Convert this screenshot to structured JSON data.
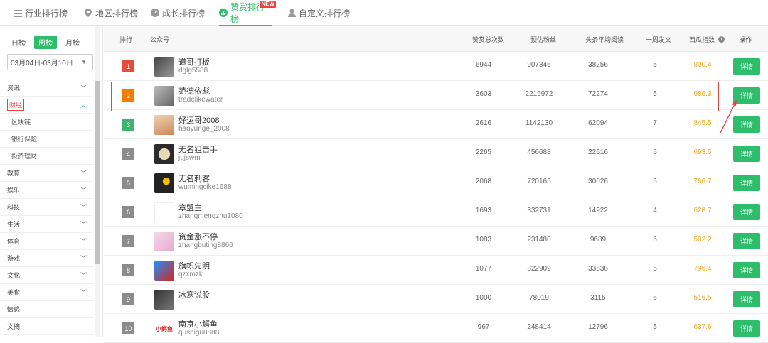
{
  "tabs": [
    {
      "label": "行业排行榜",
      "icon": "list-icon"
    },
    {
      "label": "地区排行榜",
      "icon": "location-pin-icon"
    },
    {
      "label": "成长排行榜",
      "icon": "speedometer-icon"
    },
    {
      "label": "赞赏排行榜",
      "icon": "thumbs-up-icon",
      "badge": "NEW"
    },
    {
      "label": "自定义排行榜",
      "icon": "user-icon"
    }
  ],
  "sidebar": {
    "periods": [
      "日榜",
      "周榜",
      "月榜"
    ],
    "date_range": "03月04日-03月10日",
    "categories": [
      {
        "label": "资讯"
      },
      {
        "label": "财经"
      },
      {
        "label": "区块链"
      },
      {
        "label": "银行保险"
      },
      {
        "label": "投资理财"
      },
      {
        "label": "教育"
      },
      {
        "label": "娱乐"
      },
      {
        "label": "科技"
      },
      {
        "label": "生活"
      },
      {
        "label": "体育"
      },
      {
        "label": "游戏"
      },
      {
        "label": "文化"
      },
      {
        "label": "美食"
      },
      {
        "label": "情感"
      },
      {
        "label": "文摘"
      }
    ]
  },
  "table": {
    "headers": [
      "排行",
      "公众号",
      "赞赏总次数",
      "预估粉丝",
      "头条平均阅读",
      "一周发文",
      "西瓜指数",
      "操作"
    ],
    "action_label": "详情",
    "rows": [
      {
        "rank": "1",
        "name": "道哥打板",
        "account": "dglg5588",
        "zan": "6944",
        "fans": "907346",
        "read": "38256",
        "posts": "5",
        "index": "800.4"
      },
      {
        "rank": "2",
        "name": "范德依彪",
        "account": "tradelikewater",
        "zan": "3603",
        "fans": "2219972",
        "read": "72274",
        "posts": "5",
        "index": "986.3"
      },
      {
        "rank": "3",
        "name": "好运哥2008",
        "account": "haoyunge_2008",
        "zan": "2616",
        "fans": "1142130",
        "read": "62094",
        "posts": "7",
        "index": "845.5"
      },
      {
        "rank": "4",
        "name": "无名狙击手",
        "account": "jujswm",
        "zan": "2265",
        "fans": "456688",
        "read": "22616",
        "posts": "5",
        "index": "693.5"
      },
      {
        "rank": "5",
        "name": "无名刺客",
        "account": "wumingcike1688",
        "zan": "2068",
        "fans": "720165",
        "read": "30026",
        "posts": "5",
        "index": "766.7"
      },
      {
        "rank": "6",
        "name": "章盟主",
        "account": "zhangmengzhu1080",
        "zan": "1693",
        "fans": "332731",
        "read": "14922",
        "posts": "4",
        "index": "628.7"
      },
      {
        "rank": "7",
        "name": "资金涨不停",
        "account": "zhangbuting8866",
        "zan": "1083",
        "fans": "231480",
        "read": "9689",
        "posts": "5",
        "index": "582.2"
      },
      {
        "rank": "8",
        "name": "旗帜先明",
        "account": "qzxmzk",
        "zan": "1077",
        "fans": "822909",
        "read": "33636",
        "posts": "5",
        "index": "796.4"
      },
      {
        "rank": "9",
        "name": "冰寒说股",
        "account": "",
        "zan": "1000",
        "fans": "78019",
        "read": "3115",
        "posts": "6",
        "index": "516.5"
      },
      {
        "rank": "10",
        "name": "南京小鳄鱼",
        "account": "qushigu8888",
        "zan": "967",
        "fans": "248414",
        "read": "12796",
        "posts": "5",
        "index": "637.6",
        "avatar_text": "小鳄鱼"
      }
    ]
  },
  "colors": {
    "accent": "#2ebd6b",
    "rank1": "#e64c3c",
    "rank2": "#f57c00",
    "rank3": "#3cb371",
    "rank_other": "#8c8c8c",
    "index": "#f5a623",
    "highlight": "#e64340"
  }
}
